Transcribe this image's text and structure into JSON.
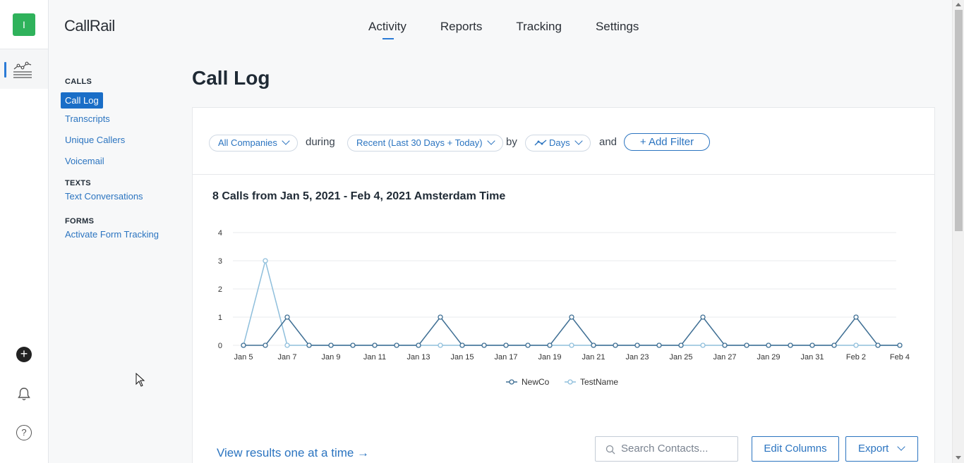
{
  "app": {
    "brand": "CallRail",
    "account_initial": "I",
    "accent_color": "#2b7bd6",
    "account_color": "#2fb25b"
  },
  "rail": {
    "icons": [
      "activity-chart-icon",
      "plus-icon",
      "bell-icon",
      "help-icon"
    ],
    "help_glyph": "?",
    "plus_glyph": "+"
  },
  "topnav": {
    "items": [
      {
        "label": "Activity",
        "active": true
      },
      {
        "label": "Reports",
        "active": false
      },
      {
        "label": "Tracking",
        "active": false
      },
      {
        "label": "Settings",
        "active": false
      }
    ]
  },
  "subnav": {
    "groups": [
      {
        "heading": "CALLS",
        "items": [
          "Call Log",
          "Transcripts",
          "Unique Callers",
          "Voicemail"
        ]
      },
      {
        "heading": "TEXTS",
        "items": [
          "Text Conversations"
        ]
      },
      {
        "heading": "FORMS",
        "items": [
          "Activate Form Tracking"
        ]
      }
    ],
    "active": "Call Log"
  },
  "page": {
    "title": "Call Log"
  },
  "filters": {
    "company": "All Companies",
    "during_word": "during",
    "range": "Recent (Last 30 Days + Today)",
    "by_word": "by",
    "granularity": "Days",
    "and_word": "and",
    "add_filter": "+ Add Filter"
  },
  "summary": {
    "title": "8 Calls from Jan 5, 2021 - Feb 4, 2021 Amsterdam Time"
  },
  "chart_data": {
    "type": "line",
    "x": [
      "Jan 5",
      "Jan 6",
      "Jan 7",
      "Jan 8",
      "Jan 9",
      "Jan 10",
      "Jan 11",
      "Jan 12",
      "Jan 13",
      "Jan 14",
      "Jan 15",
      "Jan 16",
      "Jan 17",
      "Jan 18",
      "Jan 19",
      "Jan 20",
      "Jan 21",
      "Jan 22",
      "Jan 23",
      "Jan 24",
      "Jan 25",
      "Jan 26",
      "Jan 27",
      "Jan 28",
      "Jan 29",
      "Jan 30",
      "Jan 31",
      "Feb 1",
      "Feb 2",
      "Feb 3",
      "Feb 4"
    ],
    "tick_labels": [
      "Jan 5",
      "Jan 7",
      "Jan 9",
      "Jan 11",
      "Jan 13",
      "Jan 15",
      "Jan 17",
      "Jan 19",
      "Jan 21",
      "Jan 23",
      "Jan 25",
      "Jan 27",
      "Jan 29",
      "Jan 31",
      "Feb 2",
      "Feb 4"
    ],
    "y_ticks": [
      0,
      1,
      2,
      3,
      4
    ],
    "ylim": [
      0,
      4
    ],
    "series": [
      {
        "name": "NewCo",
        "color": "#3f6f94",
        "values": [
          0,
          0,
          1,
          0,
          0,
          0,
          0,
          0,
          0,
          1,
          0,
          0,
          0,
          0,
          0,
          1,
          0,
          0,
          0,
          0,
          0,
          1,
          0,
          0,
          0,
          0,
          0,
          0,
          1,
          0,
          0
        ]
      },
      {
        "name": "TestName",
        "color": "#8fbfdc",
        "values": [
          0,
          3,
          0,
          0,
          0,
          0,
          0,
          0,
          0,
          0,
          0,
          0,
          0,
          0,
          0,
          0,
          0,
          0,
          0,
          0,
          0,
          0,
          0,
          0,
          0,
          0,
          0,
          0,
          0,
          0,
          0
        ]
      }
    ],
    "legend": "bottom-center",
    "grid": true
  },
  "footer": {
    "view_one": "View results one at a time →",
    "search_placeholder": "Search Contacts...",
    "edit_columns": "Edit Columns",
    "export": "Export"
  }
}
